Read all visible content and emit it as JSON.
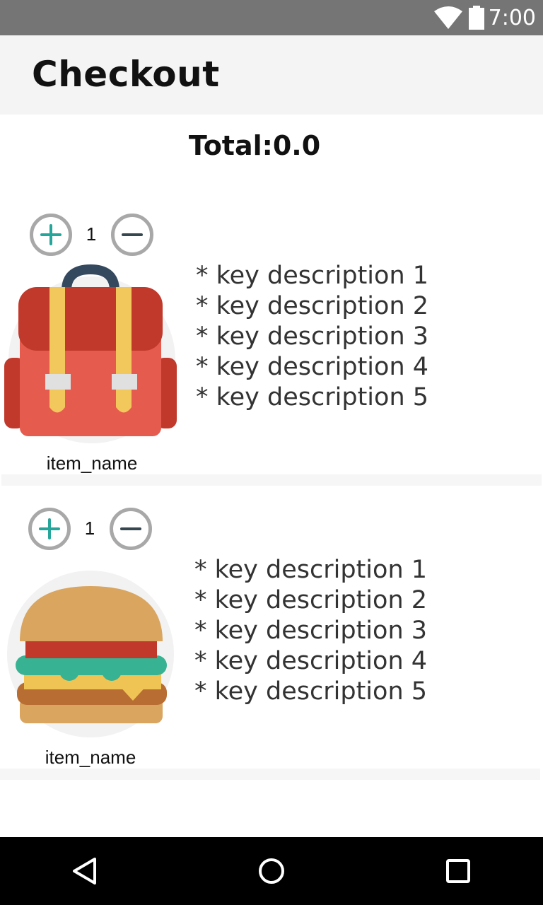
{
  "status_bar": {
    "time": "7:00",
    "icons": [
      "wifi-icon",
      "battery-icon"
    ]
  },
  "app_bar": {
    "title": "Checkout"
  },
  "total": {
    "label": "Total:",
    "value": "0.0"
  },
  "items": [
    {
      "quantity": "1",
      "name": "item_name",
      "image_icon": "backpack-icon",
      "descriptions": [
        "* key description 1",
        "* key description 2",
        "* key description 3",
        "* key description 4",
        "* key description 5"
      ]
    },
    {
      "quantity": "1",
      "name": "item_name",
      "image_icon": "burger-icon",
      "descriptions": [
        "* key description 1",
        "* key description 2",
        "* key description 3",
        "* key description 4",
        "* key description 5"
      ]
    }
  ],
  "nav_bar": {
    "icons": [
      "back-icon",
      "home-icon",
      "recents-icon"
    ]
  },
  "colors": {
    "status_bar": "#757575",
    "app_bar": "#f4f4f4",
    "accent_plus": "#26a69a",
    "button_ring": "#a8a8a8",
    "nav_bar": "#000000"
  }
}
